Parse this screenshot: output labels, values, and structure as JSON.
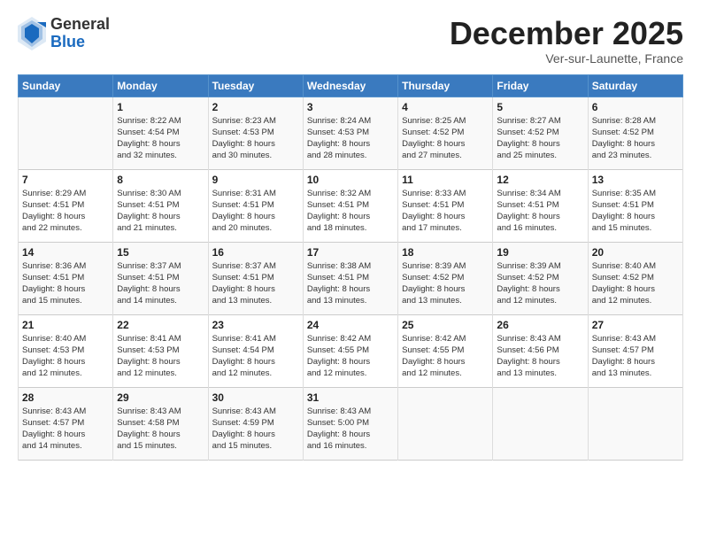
{
  "logo": {
    "general": "General",
    "blue": "Blue"
  },
  "title": "December 2025",
  "location": "Ver-sur-Launette, France",
  "headers": [
    "Sunday",
    "Monday",
    "Tuesday",
    "Wednesday",
    "Thursday",
    "Friday",
    "Saturday"
  ],
  "weeks": [
    [
      {
        "day": "",
        "info": ""
      },
      {
        "day": "1",
        "info": "Sunrise: 8:22 AM\nSunset: 4:54 PM\nDaylight: 8 hours\nand 32 minutes."
      },
      {
        "day": "2",
        "info": "Sunrise: 8:23 AM\nSunset: 4:53 PM\nDaylight: 8 hours\nand 30 minutes."
      },
      {
        "day": "3",
        "info": "Sunrise: 8:24 AM\nSunset: 4:53 PM\nDaylight: 8 hours\nand 28 minutes."
      },
      {
        "day": "4",
        "info": "Sunrise: 8:25 AM\nSunset: 4:52 PM\nDaylight: 8 hours\nand 27 minutes."
      },
      {
        "day": "5",
        "info": "Sunrise: 8:27 AM\nSunset: 4:52 PM\nDaylight: 8 hours\nand 25 minutes."
      },
      {
        "day": "6",
        "info": "Sunrise: 8:28 AM\nSunset: 4:52 PM\nDaylight: 8 hours\nand 23 minutes."
      }
    ],
    [
      {
        "day": "7",
        "info": "Sunrise: 8:29 AM\nSunset: 4:51 PM\nDaylight: 8 hours\nand 22 minutes."
      },
      {
        "day": "8",
        "info": "Sunrise: 8:30 AM\nSunset: 4:51 PM\nDaylight: 8 hours\nand 21 minutes."
      },
      {
        "day": "9",
        "info": "Sunrise: 8:31 AM\nSunset: 4:51 PM\nDaylight: 8 hours\nand 20 minutes."
      },
      {
        "day": "10",
        "info": "Sunrise: 8:32 AM\nSunset: 4:51 PM\nDaylight: 8 hours\nand 18 minutes."
      },
      {
        "day": "11",
        "info": "Sunrise: 8:33 AM\nSunset: 4:51 PM\nDaylight: 8 hours\nand 17 minutes."
      },
      {
        "day": "12",
        "info": "Sunrise: 8:34 AM\nSunset: 4:51 PM\nDaylight: 8 hours\nand 16 minutes."
      },
      {
        "day": "13",
        "info": "Sunrise: 8:35 AM\nSunset: 4:51 PM\nDaylight: 8 hours\nand 15 minutes."
      }
    ],
    [
      {
        "day": "14",
        "info": "Sunrise: 8:36 AM\nSunset: 4:51 PM\nDaylight: 8 hours\nand 15 minutes."
      },
      {
        "day": "15",
        "info": "Sunrise: 8:37 AM\nSunset: 4:51 PM\nDaylight: 8 hours\nand 14 minutes."
      },
      {
        "day": "16",
        "info": "Sunrise: 8:37 AM\nSunset: 4:51 PM\nDaylight: 8 hours\nand 13 minutes."
      },
      {
        "day": "17",
        "info": "Sunrise: 8:38 AM\nSunset: 4:51 PM\nDaylight: 8 hours\nand 13 minutes."
      },
      {
        "day": "18",
        "info": "Sunrise: 8:39 AM\nSunset: 4:52 PM\nDaylight: 8 hours\nand 13 minutes."
      },
      {
        "day": "19",
        "info": "Sunrise: 8:39 AM\nSunset: 4:52 PM\nDaylight: 8 hours\nand 12 minutes."
      },
      {
        "day": "20",
        "info": "Sunrise: 8:40 AM\nSunset: 4:52 PM\nDaylight: 8 hours\nand 12 minutes."
      }
    ],
    [
      {
        "day": "21",
        "info": "Sunrise: 8:40 AM\nSunset: 4:53 PM\nDaylight: 8 hours\nand 12 minutes."
      },
      {
        "day": "22",
        "info": "Sunrise: 8:41 AM\nSunset: 4:53 PM\nDaylight: 8 hours\nand 12 minutes."
      },
      {
        "day": "23",
        "info": "Sunrise: 8:41 AM\nSunset: 4:54 PM\nDaylight: 8 hours\nand 12 minutes."
      },
      {
        "day": "24",
        "info": "Sunrise: 8:42 AM\nSunset: 4:55 PM\nDaylight: 8 hours\nand 12 minutes."
      },
      {
        "day": "25",
        "info": "Sunrise: 8:42 AM\nSunset: 4:55 PM\nDaylight: 8 hours\nand 12 minutes."
      },
      {
        "day": "26",
        "info": "Sunrise: 8:43 AM\nSunset: 4:56 PM\nDaylight: 8 hours\nand 13 minutes."
      },
      {
        "day": "27",
        "info": "Sunrise: 8:43 AM\nSunset: 4:57 PM\nDaylight: 8 hours\nand 13 minutes."
      }
    ],
    [
      {
        "day": "28",
        "info": "Sunrise: 8:43 AM\nSunset: 4:57 PM\nDaylight: 8 hours\nand 14 minutes."
      },
      {
        "day": "29",
        "info": "Sunrise: 8:43 AM\nSunset: 4:58 PM\nDaylight: 8 hours\nand 15 minutes."
      },
      {
        "day": "30",
        "info": "Sunrise: 8:43 AM\nSunset: 4:59 PM\nDaylight: 8 hours\nand 15 minutes."
      },
      {
        "day": "31",
        "info": "Sunrise: 8:43 AM\nSunset: 5:00 PM\nDaylight: 8 hours\nand 16 minutes."
      },
      {
        "day": "",
        "info": ""
      },
      {
        "day": "",
        "info": ""
      },
      {
        "day": "",
        "info": ""
      }
    ]
  ]
}
